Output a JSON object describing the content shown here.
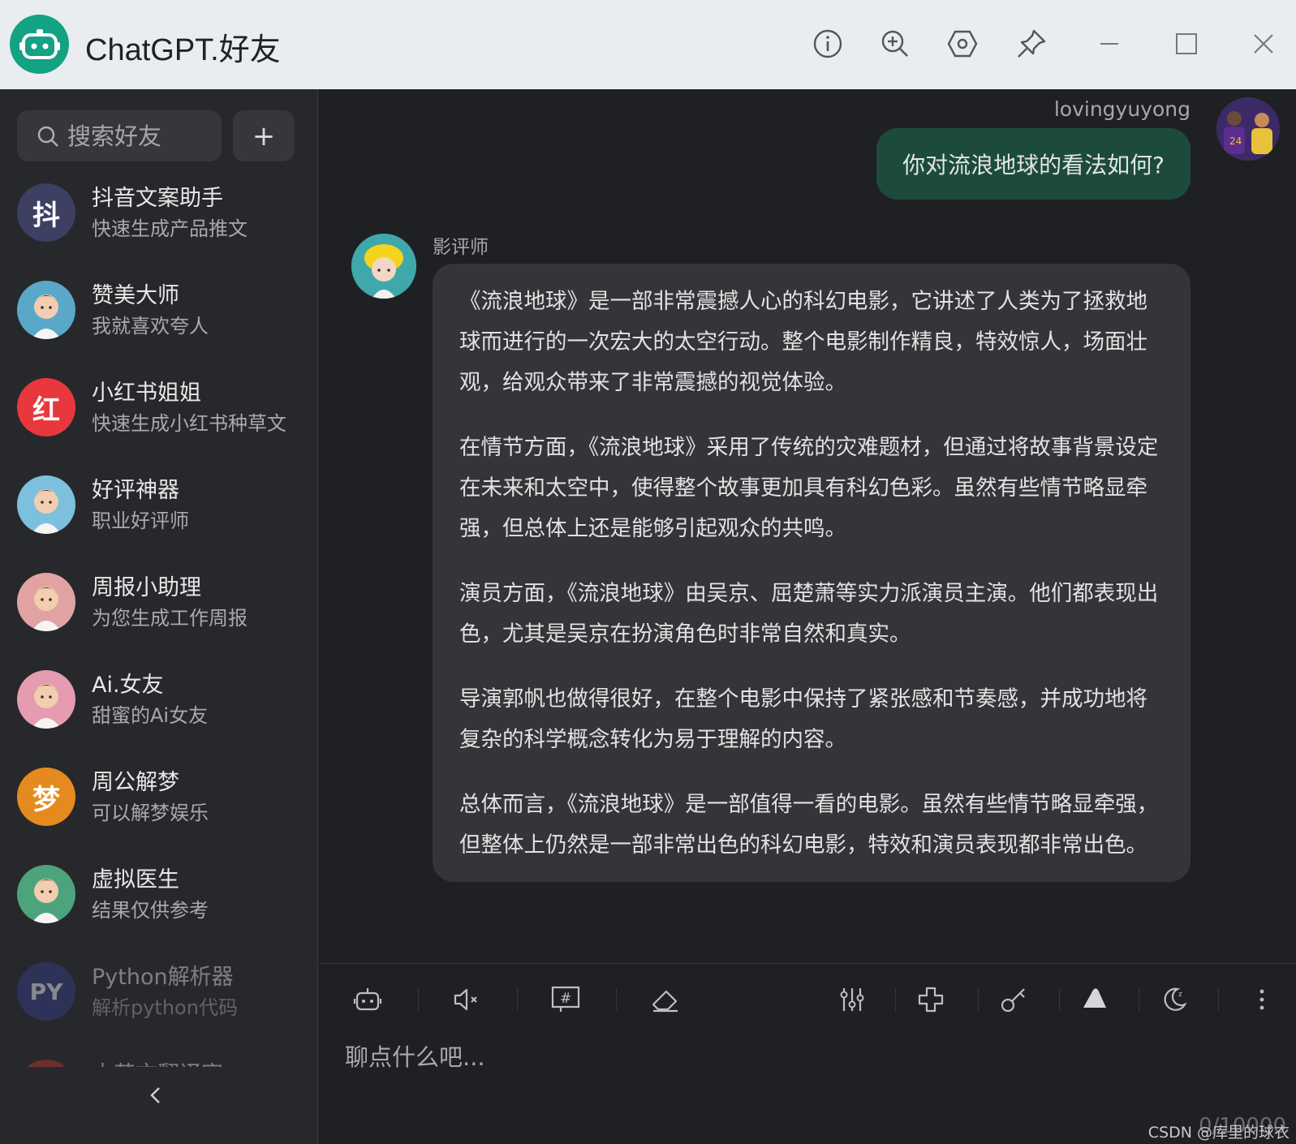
{
  "app": {
    "title": "ChatGPT.好友"
  },
  "titlebar": {
    "buttons": [
      "info-icon",
      "zoom-in-icon",
      "settings-hex-icon",
      "pin-icon",
      "minimize-icon",
      "maximize-icon",
      "close-icon"
    ]
  },
  "sidebar": {
    "search_placeholder": "搜索好友",
    "add_label": "+",
    "friends": [
      {
        "name": "抖音文案助手",
        "desc": "快速生成产品推文",
        "avatar_text": "抖",
        "color": "#3d3f63"
      },
      {
        "name": "赞美大师",
        "desc": "我就喜欢夸人",
        "avatar_text": "",
        "color": "#5aa8c9"
      },
      {
        "name": "小红书姐姐",
        "desc": "快速生成小红书种草文",
        "avatar_text": "红",
        "color": "#e8383d"
      },
      {
        "name": "好评神器",
        "desc": "职业好评师",
        "avatar_text": "",
        "color": "#7cc0dd"
      },
      {
        "name": "周报小助理",
        "desc": "为您生成工作周报",
        "avatar_text": "",
        "color": "#e1a3a2"
      },
      {
        "name": "Ai.女友",
        "desc": "甜蜜的Ai女友",
        "avatar_text": "",
        "color": "#e59bb0"
      },
      {
        "name": "周公解梦",
        "desc": "可以解梦娱乐",
        "avatar_text": "梦",
        "color": "#e58a1e"
      },
      {
        "name": "虚拟医生",
        "desc": "结果仅供参考",
        "avatar_text": "",
        "color": "#4da37c"
      },
      {
        "name": "Python解析器",
        "desc": "解析python代码",
        "avatar_text": "PY",
        "color": "#3a3f8f"
      },
      {
        "name": "中英文翻译官",
        "desc": "",
        "avatar_text": "",
        "color": "#c0392b"
      }
    ]
  },
  "chat": {
    "user": {
      "name": "lovingyuyong",
      "message": "你对流浪地球的看法如何?"
    },
    "bot": {
      "name": "影评师",
      "paragraphs": [
        "《流浪地球》是一部非常震撼人心的科幻电影，它讲述了人类为了拯救地球而进行的一次宏大的太空行动。整个电影制作精良，特效惊人，场面壮观，给观众带来了非常震撼的视觉体验。",
        "在情节方面，《流浪地球》采用了传统的灾难题材，但通过将故事背景设定在未来和太空中，使得整个故事更加具有科幻色彩。虽然有些情节略显牵强，但总体上还是能够引起观众的共鸣。",
        "演员方面，《流浪地球》由吴京、屈楚萧等实力派演员主演。他们都表现出色，尤其是吴京在扮演角色时非常自然和真实。",
        "导演郭帆也做得很好，在整个电影中保持了紧张感和节奏感，并成功地将复杂的科学概念转化为易于理解的内容。",
        "总体而言，《流浪地球》是一部值得一看的电影。虽然有些情节略显牵强，但整体上仍然是一部非常出色的科幻电影，特效和演员表现都非常出色。"
      ]
    }
  },
  "composer": {
    "placeholder": "聊点什么吧...",
    "counter": "0/10000",
    "watermark": "CSDN @库里的球衣"
  }
}
